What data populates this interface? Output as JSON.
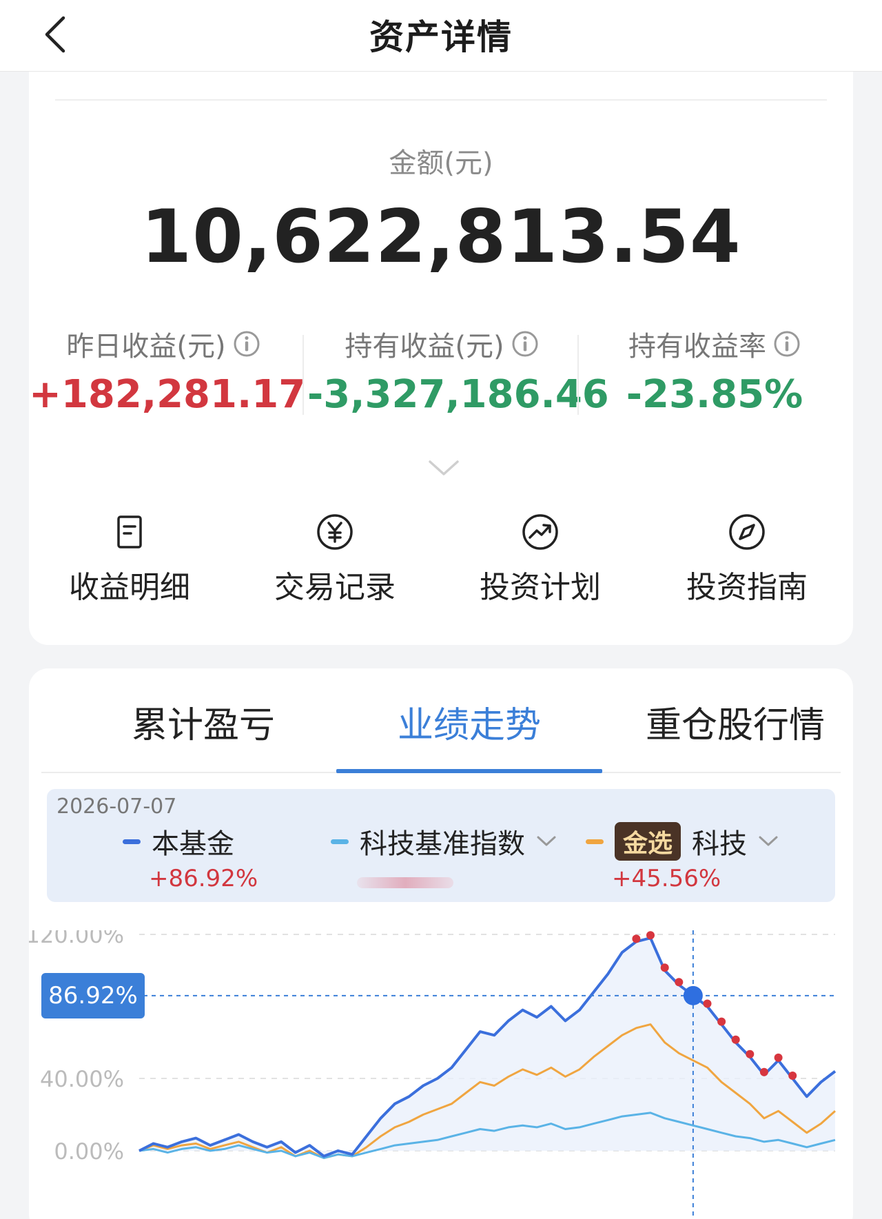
{
  "header": {
    "title": "资产详情",
    "back_icon": "chevron-left-icon"
  },
  "summary": {
    "amount_label": "金额(元)",
    "amount_value": "10,622,813.54",
    "stats": [
      {
        "label": "昨日收益(元)",
        "value": "+182,281.17",
        "tone": "positive"
      },
      {
        "label": "持有收益(元)",
        "value": "-3,327,186.46",
        "tone": "negative"
      },
      {
        "label": "持有收益率",
        "value": "-23.85%",
        "tone": "negative"
      }
    ],
    "expand_icon": "chevron-down-icon"
  },
  "actions": [
    {
      "label": "收益明细",
      "icon": "document-icon"
    },
    {
      "label": "交易记录",
      "icon": "yen-circle-icon"
    },
    {
      "label": "投资计划",
      "icon": "trend-circle-icon"
    },
    {
      "label": "投资指南",
      "icon": "compass-icon"
    }
  ],
  "tabs": [
    {
      "label": "累计盈亏",
      "active": false
    },
    {
      "label": "业绩走势",
      "active": true
    },
    {
      "label": "重仓股行情",
      "active": false
    }
  ],
  "legend": {
    "date": "2026-07-07",
    "items": [
      {
        "name": "本基金",
        "value": "+86.92%",
        "color": "#3b6fdc"
      },
      {
        "name": "科技基准指数",
        "value": "",
        "color": "#5ab3e6"
      },
      {
        "badge": "金选",
        "name": "科技",
        "value": "+45.56%",
        "color": "#f0a540"
      }
    ]
  },
  "chart_data": {
    "type": "line",
    "y_ticks": [
      "120.00%",
      "40.00%",
      "0.00%"
    ],
    "ylim": [
      0,
      120
    ],
    "current_value_label": "86.92%",
    "series": [
      {
        "name": "本基金",
        "color": "#3b6fdc",
        "values": [
          0,
          4,
          2,
          5,
          7,
          3,
          6,
          9,
          5,
          2,
          5,
          -1,
          3,
          -3,
          0,
          -2,
          8,
          18,
          26,
          30,
          36,
          40,
          46,
          56,
          66,
          64,
          72,
          78,
          74,
          80,
          72,
          78,
          88,
          98,
          110,
          116,
          118,
          100,
          92,
          86,
          80,
          70,
          60,
          52,
          42,
          50,
          40,
          30,
          38,
          44
        ]
      },
      {
        "name": "科技基准指数",
        "color": "#5ab3e6",
        "values": [
          0,
          1,
          -1,
          1,
          2,
          0,
          1,
          3,
          1,
          -1,
          0,
          -3,
          -1,
          -4,
          -2,
          -3,
          -1,
          1,
          3,
          4,
          5,
          6,
          8,
          10,
          12,
          11,
          13,
          14,
          13,
          15,
          12,
          13,
          15,
          17,
          19,
          20,
          21,
          18,
          16,
          14,
          12,
          10,
          8,
          7,
          5,
          6,
          4,
          2,
          4,
          6
        ]
      },
      {
        "name": "科技",
        "color": "#f0a540",
        "values": [
          0,
          3,
          1,
          3,
          4,
          1,
          3,
          5,
          2,
          -1,
          2,
          -3,
          0,
          -4,
          -2,
          -3,
          2,
          8,
          13,
          16,
          20,
          23,
          26,
          32,
          38,
          36,
          41,
          45,
          42,
          46,
          41,
          45,
          52,
          58,
          64,
          68,
          70,
          60,
          54,
          50,
          46,
          38,
          32,
          26,
          18,
          22,
          16,
          10,
          15,
          22
        ]
      }
    ]
  }
}
